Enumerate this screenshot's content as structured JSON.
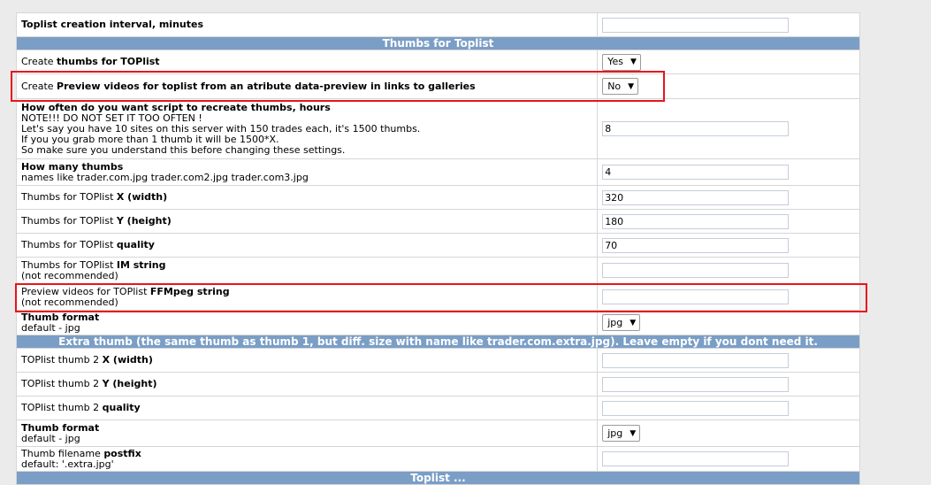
{
  "rows": {
    "interval": {
      "label_bold": "Toplist creation interval, minutes",
      "value": ""
    },
    "header_thumbs": {
      "text": "Thumbs for Toplist"
    },
    "create_thumbs": {
      "label_pre": "Create ",
      "label_bold": "thumbs for TOPlist",
      "value": "Yes"
    },
    "create_preview": {
      "label_pre": "Create ",
      "label_bold": "Preview videos for toplist from an atribute data-preview in links to galleries",
      "value": "No"
    },
    "recreate": {
      "label_bold": "How often do you want script to recreate thumbs, hours",
      "note_lines": [
        "NOTE!!! DO NOT SET IT TOO OFTEN !",
        "Let's say you have 10 sites on this server with 150 trades each, it's 1500 thumbs.",
        "If you you grab more than 1 thumb it will be 1500*X.",
        "So make sure you understand this before changing these settings."
      ],
      "value": "8"
    },
    "how_many": {
      "label_bold": "How many thumbs",
      "sub": "names like trader.com.jpg trader.com2.jpg trader.com3.jpg",
      "value": "4"
    },
    "thumb_x": {
      "label_pre": "Thumbs for TOPlist ",
      "label_bold": "X (width)",
      "value": "320"
    },
    "thumb_y": {
      "label_pre": "Thumbs for TOPlist ",
      "label_bold": "Y (height)",
      "value": "180"
    },
    "thumb_quality": {
      "label_pre": "Thumbs for TOPlist ",
      "label_bold": "quality",
      "value": "70"
    },
    "im_string": {
      "label_pre": "Thumbs for TOPlist ",
      "label_bold": "IM string",
      "sub": "(not recommended)",
      "value": ""
    },
    "ffmpeg_string": {
      "label_pre": "Preview videos for TOPlist ",
      "label_bold": "FFMpeg string",
      "sub": "(not recommended)",
      "value": ""
    },
    "thumb_format": {
      "label_bold": "Thumb format",
      "sub": "default - jpg",
      "value": "jpg"
    },
    "header_extra": {
      "text": "Extra thumb (the same thumb as thumb 1, but diff. size with name like trader.com.extra.jpg). Leave empty if you dont need it."
    },
    "extra_x": {
      "label_pre": "TOPlist thumb 2 ",
      "label_bold": "X (width)",
      "value": ""
    },
    "extra_y": {
      "label_pre": "TOPlist thumb 2 ",
      "label_bold": "Y (height)",
      "value": ""
    },
    "extra_quality": {
      "label_pre": "TOPlist thumb 2 ",
      "label_bold": "quality",
      "value": ""
    },
    "extra_format": {
      "label_bold": "Thumb format",
      "sub": "default - jpg",
      "value": "jpg"
    },
    "extra_postfix": {
      "label_pre": "Thumb filename ",
      "label_bold": "postfix",
      "sub": "default: '.extra.jpg'",
      "value": ""
    },
    "header_bottom": {
      "text": "Toplist ..."
    }
  },
  "colors": {
    "header_bg": "#7a9ec6",
    "highlight": "#e8141b"
  }
}
